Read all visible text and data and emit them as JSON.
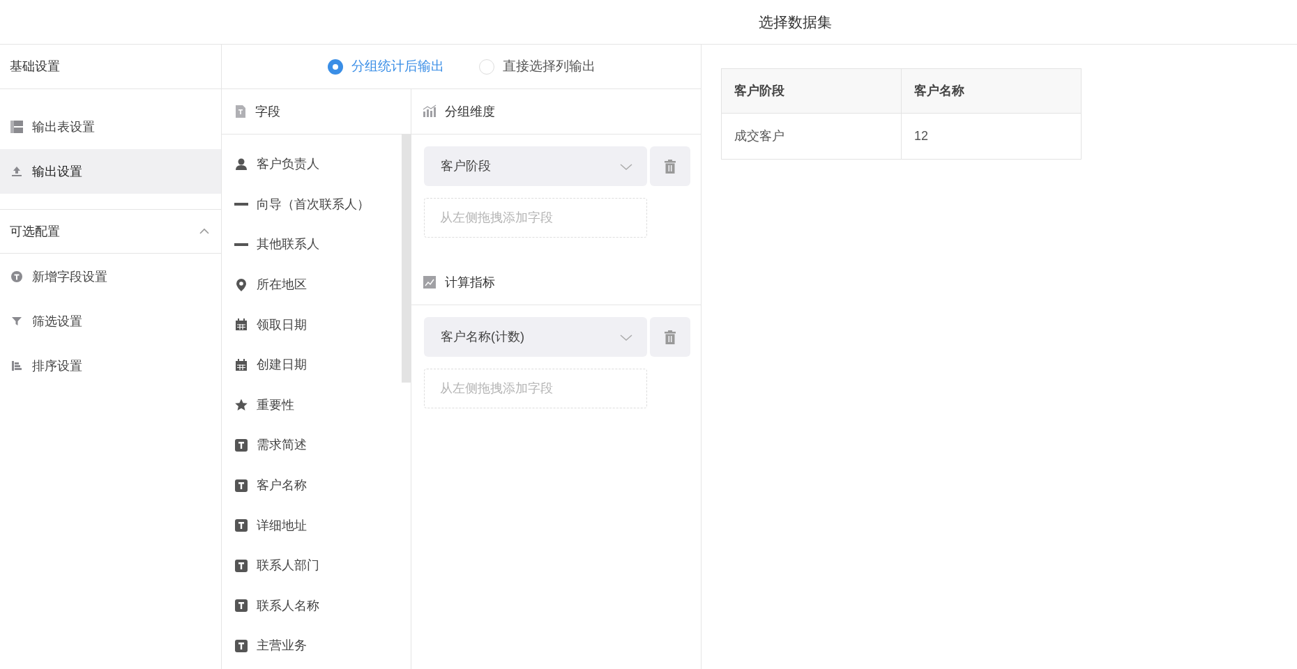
{
  "title": "选择数据集",
  "sidebar": {
    "sections": [
      {
        "title": "基础设置",
        "items": [
          {
            "label": "输出表设置",
            "kind": "table",
            "selected": false
          },
          {
            "label": "输出设置",
            "kind": "upload",
            "selected": true
          }
        ]
      },
      {
        "title": "可选配置",
        "expanded": true,
        "items": [
          {
            "label": "新增字段设置",
            "kind": "circle-t",
            "selected": false
          },
          {
            "label": "筛选设置",
            "kind": "filter",
            "selected": false
          },
          {
            "label": "排序设置",
            "kind": "sort",
            "selected": false
          }
        ]
      }
    ]
  },
  "output_modes": [
    {
      "label": "分组统计后输出",
      "selected": true
    },
    {
      "label": "直接选择列输出",
      "selected": false
    }
  ],
  "fields": {
    "title": "字段",
    "items": [
      {
        "label": "客户负责人",
        "kind": "user"
      },
      {
        "label": "向导（首次联系人）",
        "kind": "dash"
      },
      {
        "label": "其他联系人",
        "kind": "dash"
      },
      {
        "label": "所在地区",
        "kind": "location"
      },
      {
        "label": "领取日期",
        "kind": "date"
      },
      {
        "label": "创建日期",
        "kind": "date"
      },
      {
        "label": "重要性",
        "kind": "star"
      },
      {
        "label": "需求简述",
        "kind": "text"
      },
      {
        "label": "客户名称",
        "kind": "text"
      },
      {
        "label": "详细地址",
        "kind": "text"
      },
      {
        "label": "联系人部门",
        "kind": "text"
      },
      {
        "label": "联系人名称",
        "kind": "text"
      },
      {
        "label": "主营业务",
        "kind": "text"
      }
    ]
  },
  "groups": [
    {
      "title": "分组维度",
      "kind": "bar",
      "selected_fields": [
        "客户阶段"
      ],
      "drop_placeholder": "从左侧拖拽添加字段"
    },
    {
      "title": "计算指标",
      "kind": "metric",
      "selected_fields": [
        "客户名称(计数)"
      ],
      "drop_placeholder": "从左侧拖拽添加字段"
    }
  ],
  "preview": {
    "columns": [
      "客户阶段",
      "客户名称"
    ],
    "rows": [
      [
        "成交客户",
        "12"
      ]
    ]
  }
}
